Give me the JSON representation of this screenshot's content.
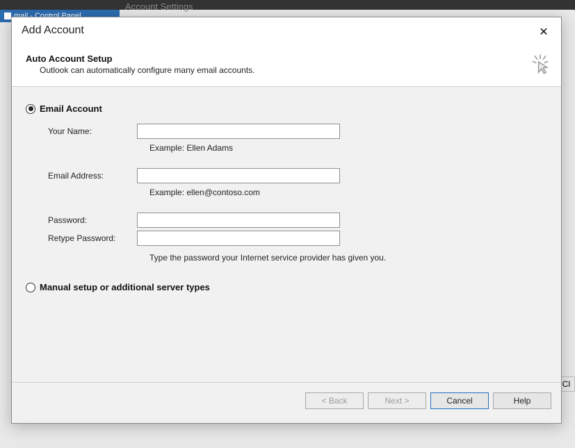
{
  "background": {
    "window_title": "mail - Control Panel",
    "tab_hint": "Account Settings",
    "right_btn_fragment": "Cl"
  },
  "dialog": {
    "title": "Add Account",
    "section_title": "Auto Account Setup",
    "section_desc": "Outlook can automatically configure many email accounts.",
    "options": {
      "email_account": {
        "label": "Email Account",
        "checked": true
      },
      "manual_setup": {
        "label": "Manual setup or additional server types",
        "checked": false
      }
    },
    "fields": {
      "your_name": {
        "label": "Your Name:",
        "value": "",
        "example": "Example: Ellen Adams"
      },
      "email": {
        "label": "Email Address:",
        "value": "",
        "example": "Example: ellen@contoso.com"
      },
      "password": {
        "label": "Password:",
        "value": ""
      },
      "retype_password": {
        "label": "Retype Password:",
        "value": ""
      },
      "password_hint": "Type the password your Internet service provider has given you."
    },
    "buttons": {
      "back": "< Back",
      "next": "Next >",
      "cancel": "Cancel",
      "help": "Help"
    }
  }
}
